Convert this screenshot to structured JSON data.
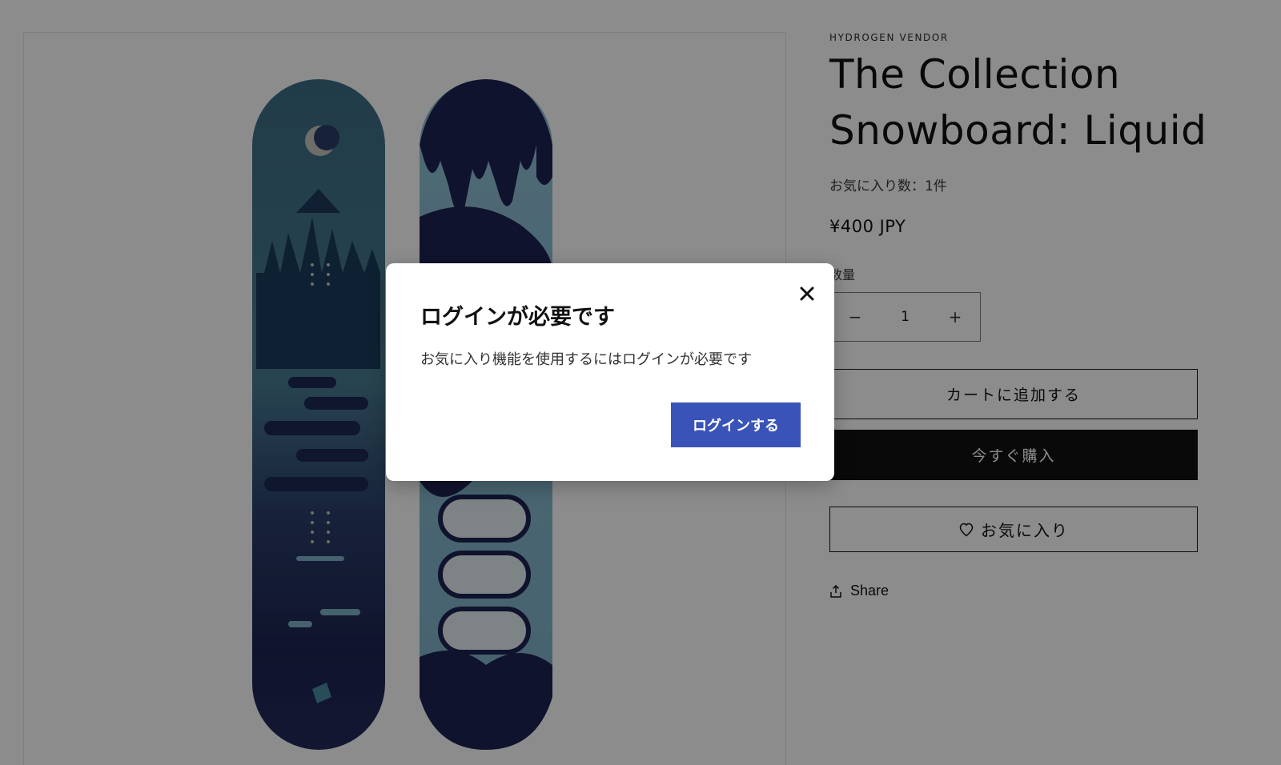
{
  "product": {
    "vendor": "HYDROGEN VENDOR",
    "title": "The Collection Snowboard: Liquid",
    "favorite_count": "お気に入り数：1件",
    "price": "¥400 JPY",
    "quantity_label": "数量",
    "quantity_value": "1",
    "quantity_minus": "−",
    "quantity_plus": "+",
    "add_to_cart": "カートに追加する",
    "buy_now": "今すぐ購入",
    "favorite_button": "お気に入り",
    "share": "Share"
  },
  "modal": {
    "title": "ログインが必要です",
    "body": "お気に入り機能を使用するにはログインが必要です",
    "login_button": "ログインする",
    "close_icon": "close-icon"
  },
  "colors": {
    "overlay": "rgba(0,0,0,0.45)",
    "login_button": "#3a53b8",
    "buy_now_bg": "#121212",
    "board_teal": "#3f6f86",
    "board_navy": "#1f2550"
  },
  "icons": {
    "heart": "heart-icon",
    "share": "share-icon",
    "close": "close-icon"
  }
}
